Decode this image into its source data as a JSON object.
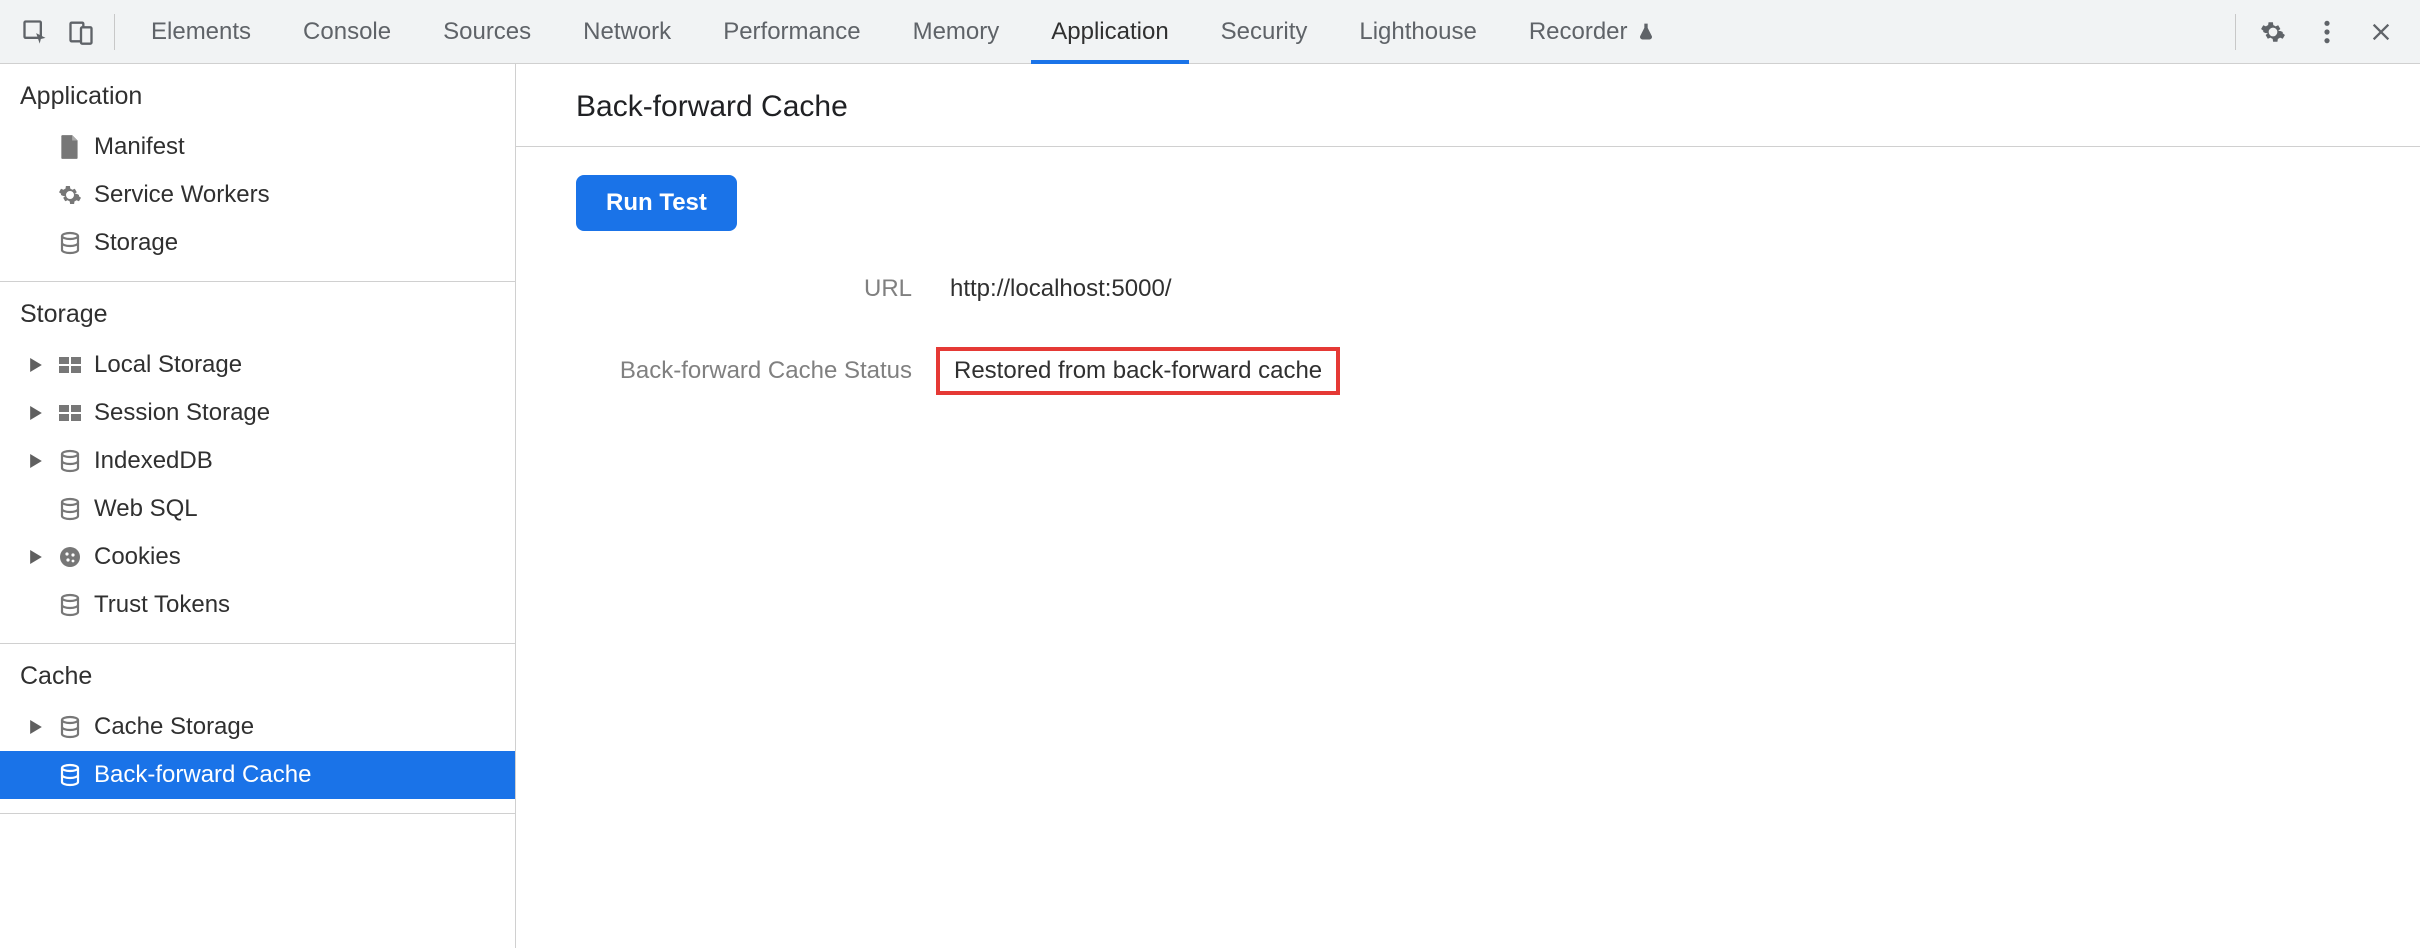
{
  "tabs": {
    "items": [
      {
        "label": "Elements",
        "active": false
      },
      {
        "label": "Console",
        "active": false
      },
      {
        "label": "Sources",
        "active": false
      },
      {
        "label": "Network",
        "active": false
      },
      {
        "label": "Performance",
        "active": false
      },
      {
        "label": "Memory",
        "active": false
      },
      {
        "label": "Application",
        "active": true
      },
      {
        "label": "Security",
        "active": false
      },
      {
        "label": "Lighthouse",
        "active": false
      },
      {
        "label": "Recorder",
        "active": false,
        "experimental": true
      }
    ]
  },
  "sidebar": {
    "sections": [
      {
        "title": "Application",
        "items": [
          {
            "label": "Manifest",
            "icon": "file",
            "expandable": false
          },
          {
            "label": "Service Workers",
            "icon": "gear",
            "expandable": false
          },
          {
            "label": "Storage",
            "icon": "db",
            "expandable": false
          }
        ]
      },
      {
        "title": "Storage",
        "items": [
          {
            "label": "Local Storage",
            "icon": "grid",
            "expandable": true
          },
          {
            "label": "Session Storage",
            "icon": "grid",
            "expandable": true
          },
          {
            "label": "IndexedDB",
            "icon": "db",
            "expandable": true
          },
          {
            "label": "Web SQL",
            "icon": "db",
            "expandable": false
          },
          {
            "label": "Cookies",
            "icon": "cookie",
            "expandable": true
          },
          {
            "label": "Trust Tokens",
            "icon": "db",
            "expandable": false
          }
        ]
      },
      {
        "title": "Cache",
        "items": [
          {
            "label": "Cache Storage",
            "icon": "db",
            "expandable": true
          },
          {
            "label": "Back-forward Cache",
            "icon": "db",
            "expandable": false,
            "selected": true
          }
        ]
      }
    ]
  },
  "content": {
    "title": "Back-forward Cache",
    "run_button": "Run Test",
    "url_label": "URL",
    "url_value": "http://localhost:5000/",
    "status_label": "Back-forward Cache Status",
    "status_value": "Restored from back-forward cache"
  }
}
